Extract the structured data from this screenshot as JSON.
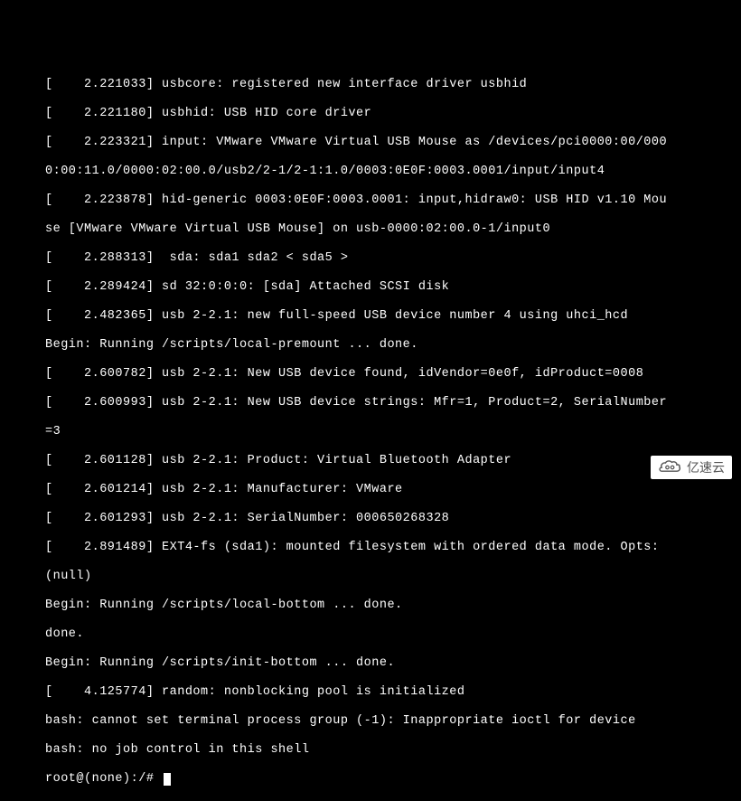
{
  "boot_log": {
    "lines": [
      "[    2.221033] usbcore: registered new interface driver usbhid",
      "[    2.221180] usbhid: USB HID core driver",
      "[    2.223321] input: VMware VMware Virtual USB Mouse as /devices/pci0000:00/000",
      "0:00:11.0/0000:02:00.0/usb2/2-1/2-1:1.0/0003:0E0F:0003.0001/input/input4",
      "[    2.223878] hid-generic 0003:0E0F:0003.0001: input,hidraw0: USB HID v1.10 Mou",
      "se [VMware VMware Virtual USB Mouse] on usb-0000:02:00.0-1/input0",
      "[    2.288313]  sda: sda1 sda2 < sda5 >",
      "[    2.289424] sd 32:0:0:0: [sda] Attached SCSI disk",
      "[    2.482365] usb 2-2.1: new full-speed USB device number 4 using uhci_hcd",
      "Begin: Running /scripts/local-premount ... done.",
      "[    2.600782] usb 2-2.1: New USB device found, idVendor=0e0f, idProduct=0008",
      "[    2.600993] usb 2-2.1: New USB device strings: Mfr=1, Product=2, SerialNumber",
      "=3",
      "[    2.601128] usb 2-2.1: Product: Virtual Bluetooth Adapter",
      "[    2.601214] usb 2-2.1: Manufacturer: VMware",
      "[    2.601293] usb 2-2.1: SerialNumber: 000650268328",
      "[    2.891489] EXT4-fs (sda1): mounted filesystem with ordered data mode. Opts:",
      "(null)",
      "Begin: Running /scripts/local-bottom ... done.",
      "done.",
      "Begin: Running /scripts/init-bottom ... done.",
      "[    4.125774] random: nonblocking pool is initialized",
      "bash: cannot set terminal process group (-1): Inappropriate ioctl for device",
      "bash: no job control in this shell"
    ],
    "prompt": "root@(none):/# "
  },
  "watermark": {
    "text": "亿速云"
  }
}
